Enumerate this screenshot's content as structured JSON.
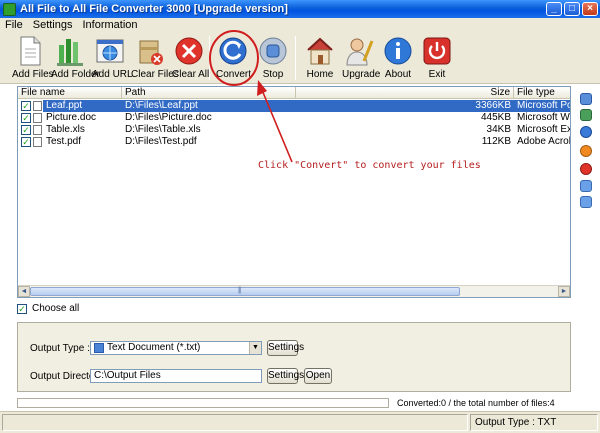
{
  "window": {
    "title": "All File to All File Converter 3000 [Upgrade version]",
    "minimize": "_",
    "maximize": "□",
    "close": "×"
  },
  "menu": [
    "File",
    "Settings",
    "Information"
  ],
  "toolbar": {
    "add_files": "Add Files",
    "add_folder": "Add Folder",
    "add_url": "Add URL",
    "clear_files": "Clear Files",
    "clear_all": "Clear All",
    "convert": "Convert",
    "stop": "Stop",
    "home": "Home",
    "upgrade": "Upgrade",
    "about": "About",
    "exit": "Exit"
  },
  "file_list": {
    "columns": {
      "name": "File name",
      "path": "Path",
      "size": "Size",
      "type": "File type"
    },
    "rows": [
      {
        "name": "Leaf.ppt",
        "path": "D:\\Files\\Leaf.ppt",
        "size": "3366KB",
        "type": "Microsoft Powe",
        "checked": true,
        "selected": true
      },
      {
        "name": "Picture.doc",
        "path": "D:\\Files\\Picture.doc",
        "size": "445KB",
        "type": "Microsoft Word",
        "checked": true,
        "selected": false
      },
      {
        "name": "Table.xls",
        "path": "D:\\Files\\Table.xls",
        "size": "34KB",
        "type": "Microsoft Excel",
        "checked": true,
        "selected": false
      },
      {
        "name": "Test.pdf",
        "path": "D:\\Files\\Test.pdf",
        "size": "112KB",
        "type": "Adobe Acrobat",
        "checked": true,
        "selected": false
      }
    ],
    "scroll_left": "◄",
    "scroll_right": "►",
    "scroll_grip": "|||"
  },
  "annotation": "Click \"Convert\" to convert your files",
  "choose_all": {
    "label": "Choose all",
    "check": "✓"
  },
  "output": {
    "type_label": "Output Type :",
    "type_value": "Text Document (*.txt)",
    "drop_arrow": "▼",
    "settings_label": "Settings",
    "dir_label": "Output Directory :",
    "dir_value": "C:\\Output Files",
    "dir_settings_label": "Settings",
    "open_label": "Open"
  },
  "progress": {
    "fraction": 0
  },
  "status": {
    "converted": "Converted:0  /  the total number of files:4",
    "output_type": "Output Type :  TXT"
  },
  "colors": {
    "accent": "#316ac5",
    "annotation": "#b51d1d",
    "title_bar": "#0054e3"
  }
}
